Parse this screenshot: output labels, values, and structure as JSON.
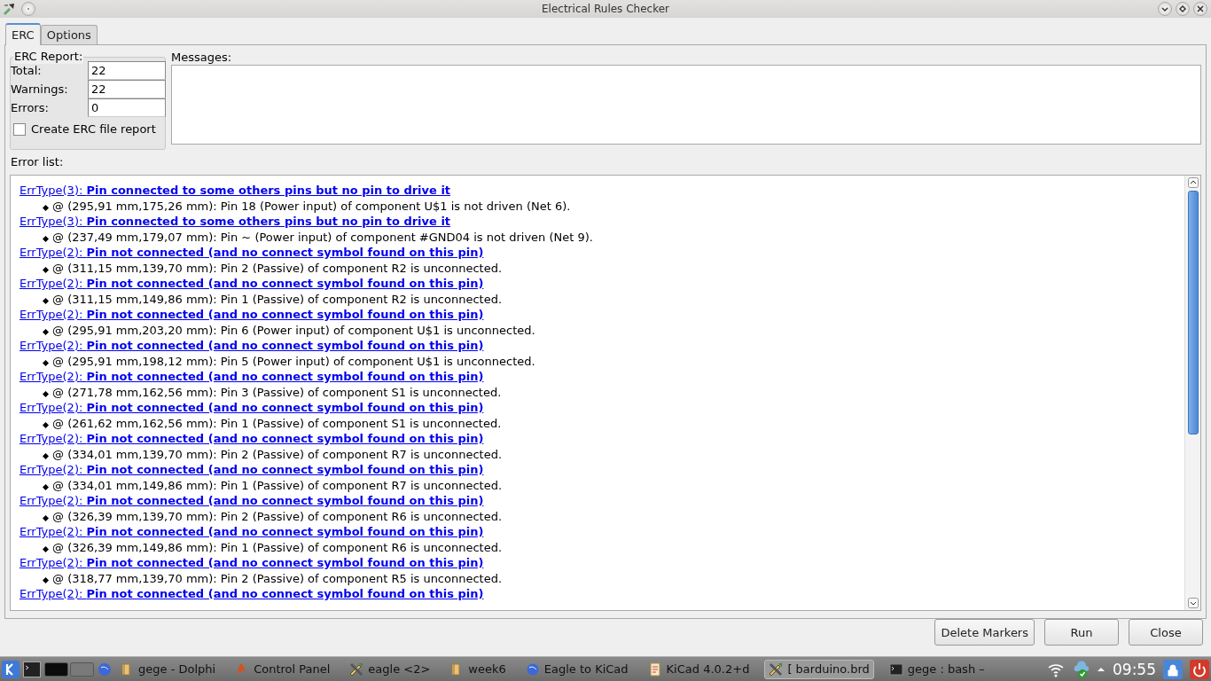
{
  "window": {
    "title": "Electrical Rules Checker"
  },
  "tabs": [
    {
      "label": "ERC",
      "selected": true
    },
    {
      "label": "Options",
      "selected": false
    }
  ],
  "report": {
    "title": "ERC Report:",
    "fields": [
      {
        "label": "Total:",
        "value": "22"
      },
      {
        "label": "Warnings:",
        "value": "22"
      },
      {
        "label": "Errors:",
        "value": "0"
      }
    ],
    "file_report": {
      "label": "Create ERC file report",
      "checked": false
    }
  },
  "messages": {
    "label": "Messages:"
  },
  "error_list": {
    "label": "Error list:",
    "items": [
      {
        "title": "ErrType(3): **Pin connected to some others pins but no pin to drive it**",
        "detail": "@ (295,91 mm,175,26 mm): Pin 18 (Power input) of component U$1 is not driven (Net 6)."
      },
      {
        "title": "ErrType(3): **Pin connected to some others pins but no pin to drive it**",
        "detail": "@ (237,49 mm,179,07 mm): Pin ~ (Power input) of component #GND04 is not driven (Net 9)."
      },
      {
        "title": "ErrType(2): **Pin not connected (and no connect symbol found on this pin)**",
        "detail": "@ (311,15 mm,139,70 mm): Pin 2 (Passive) of component R2 is unconnected."
      },
      {
        "title": "ErrType(2): **Pin not connected (and no connect symbol found on this pin)**",
        "detail": "@ (311,15 mm,149,86 mm): Pin 1 (Passive) of component R2 is unconnected."
      },
      {
        "title": "ErrType(2): **Pin not connected (and no connect symbol found on this pin)**",
        "detail": "@ (295,91 mm,203,20 mm): Pin 6 (Power input) of component U$1 is unconnected."
      },
      {
        "title": "ErrType(2): **Pin not connected (and no connect symbol found on this pin)**",
        "detail": "@ (295,91 mm,198,12 mm): Pin 5 (Power input) of component U$1 is unconnected."
      },
      {
        "title": "ErrType(2): **Pin not connected (and no connect symbol found on this pin)**",
        "detail": "@ (271,78 mm,162,56 mm): Pin 3 (Passive) of component S1 is unconnected."
      },
      {
        "title": "ErrType(2): **Pin not connected (and no connect symbol found on this pin)**",
        "detail": "@ (261,62 mm,162,56 mm): Pin 1 (Passive) of component S1 is unconnected."
      },
      {
        "title": "ErrType(2): **Pin not connected (and no connect symbol found on this pin)**",
        "detail": "@ (334,01 mm,139,70 mm): Pin 2 (Passive) of component R7 is unconnected."
      },
      {
        "title": "ErrType(2): **Pin not connected (and no connect symbol found on this pin)**",
        "detail": "@ (334,01 mm,149,86 mm): Pin 1 (Passive) of component R7 is unconnected."
      },
      {
        "title": "ErrType(2): **Pin not connected (and no connect symbol found on this pin)**",
        "detail": "@ (326,39 mm,139,70 mm): Pin 2 (Passive) of component R6 is unconnected."
      },
      {
        "title": "ErrType(2): **Pin not connected (and no connect symbol found on this pin)**",
        "detail": "@ (326,39 mm,149,86 mm): Pin 1 (Passive) of component R6 is unconnected."
      },
      {
        "title": "ErrType(2): **Pin not connected (and no connect symbol found on this pin)**",
        "detail": "@ (318,77 mm,139,70 mm): Pin 2 (Passive) of component R5 is unconnected."
      },
      {
        "title": "ErrType(2): **Pin not connected (and no connect symbol found on this pin)**"
      }
    ]
  },
  "buttons": [
    {
      "label": "Delete Markers"
    },
    {
      "label": "Run"
    },
    {
      "label": "Close"
    }
  ],
  "taskbar": {
    "items": [
      {
        "label": "gege - Dolphi",
        "kind": "folder",
        "selected": false
      },
      {
        "label": "Control Panel",
        "kind": "flame",
        "selected": false
      },
      {
        "label": "eagle <2>",
        "kind": "tool",
        "selected": false
      },
      {
        "label": "week6",
        "kind": "folder",
        "selected": false
      },
      {
        "label": "Eagle to KiCad",
        "kind": "globe",
        "selected": false
      },
      {
        "label": "KiCad 4.0.2+d",
        "kind": "doc",
        "selected": false
      },
      {
        "label": "[ barduino.brd",
        "kind": "tool",
        "selected": true
      },
      {
        "label": "gege : bash –",
        "kind": "terminal",
        "selected": false
      }
    ],
    "clock": "09:55"
  }
}
